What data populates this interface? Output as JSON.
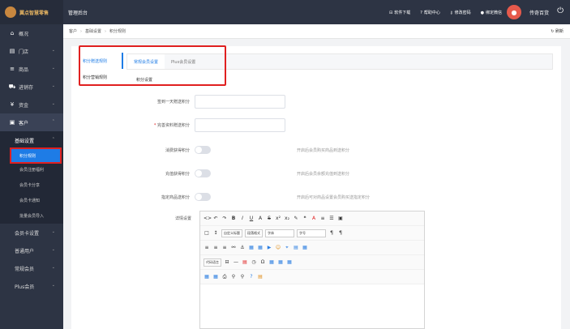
{
  "brand": {
    "name": "翼点智慧零售"
  },
  "topbar": {
    "title": "管理后台",
    "links": [
      {
        "icon": "download-icon",
        "label": "软件下载"
      },
      {
        "icon": "help-icon",
        "label": "帮助中心"
      },
      {
        "icon": "key-icon",
        "label": "修改密码"
      },
      {
        "icon": "wechat-icon",
        "label": "绑定微信"
      }
    ],
    "user": "传奇百货"
  },
  "sidebar": {
    "items": [
      {
        "icon": "home-icon",
        "label": "概况",
        "arrow": false
      },
      {
        "icon": "store-icon",
        "label": "门店",
        "arrow": true
      },
      {
        "icon": "menu-icon",
        "label": "商品",
        "arrow": true
      },
      {
        "icon": "cart-icon",
        "label": "进销存",
        "arrow": true
      },
      {
        "icon": "yen-icon",
        "label": "资金",
        "arrow": true
      },
      {
        "icon": "customer-icon",
        "label": "客户",
        "arrow": true
      }
    ],
    "sub_group": {
      "header": "基础设置",
      "items": [
        "积分规则",
        "会员注册福利",
        "会员卡分享",
        "会员卡通知",
        "批量会员导入"
      ]
    },
    "bottom_items": [
      "会员卡设置",
      "普通用户",
      "常规会员",
      "Plus会员"
    ]
  },
  "breadcrumb": {
    "items": [
      "客户",
      "基础设置",
      "积分规则"
    ],
    "refresh": "刷新"
  },
  "left_menu": {
    "items": [
      "积分赠送规则",
      "积分营销规则"
    ]
  },
  "tabs": [
    "常规会员设置",
    "Plus会员设置"
  ],
  "section_title": "积分设置",
  "form": {
    "sign_in": {
      "label": "签到一天赠送积分",
      "value": ""
    },
    "profile": {
      "label": "完善资料赠送积分",
      "value": ""
    },
    "consume": {
      "label": "消费获得积分",
      "hint": "开启后会员购买商品到送积分"
    },
    "recharge": {
      "label": "充值获得积分",
      "hint": "开启后会员余额充值到送积分"
    },
    "appoint": {
      "label": "指定商品送积分",
      "hint": "开启后可对商品设置会员购买送指定积分"
    },
    "detail": {
      "label": "详情设置"
    }
  },
  "editor": {
    "font_preset": "自定义标题",
    "paragraph": "段落格式",
    "font_family": "字体",
    "font_size": "字号",
    "code_lang": "代码语言"
  }
}
